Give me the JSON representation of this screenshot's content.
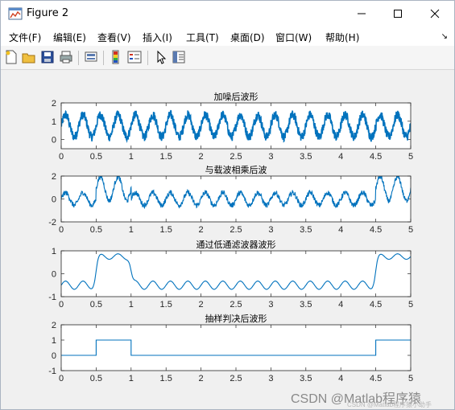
{
  "window": {
    "title": "Figure 2"
  },
  "menu": {
    "items": [
      "文件(F)",
      "编辑(E)",
      "查看(V)",
      "插入(I)",
      "工具(T)",
      "桌面(D)",
      "窗口(W)",
      "帮助(H)"
    ],
    "overflow_arrow": "↘"
  },
  "toolbar": {
    "icons": [
      "new-figure-icon",
      "open-file-icon",
      "save-icon",
      "print-icon",
      "link-plot-icon",
      "insert-colorbar-icon",
      "insert-legend-icon",
      "pointer-icon",
      "property-inspector-icon"
    ]
  },
  "colors": {
    "line": "#0072bd",
    "axes_bg": "#ffffff",
    "figure_bg": "#f0f0f0",
    "axis": "#262626"
  },
  "chart_data": [
    {
      "type": "line",
      "title": "加噪后波形",
      "xlim": [
        0,
        5
      ],
      "ylim": [
        -0.5,
        2
      ],
      "xticks": [
        "0",
        "0.5",
        "1",
        "1.5",
        "2",
        "2.5",
        "3",
        "3.5",
        "4",
        "4.5",
        "5"
      ],
      "yticks": [
        "0",
        "1",
        "2"
      ],
      "series": [
        {
          "x": [
            0,
            5
          ],
          "description_values": {
            "carrier_cycles": 20,
            "center": 0.75,
            "amplitude": 0.6,
            "noise": 0.22
          }
        }
      ]
    },
    {
      "type": "line",
      "title": "与载波相乘后波",
      "xlim": [
        0,
        5
      ],
      "ylim": [
        -2,
        2
      ],
      "xticks": [
        "0",
        "0.5",
        "1",
        "1.5",
        "2",
        "2.5",
        "3",
        "3.5",
        "4",
        "4.5",
        "5"
      ],
      "yticks": [
        "-2",
        "0",
        "2"
      ],
      "series": [
        {
          "x": [
            0,
            5
          ],
          "description_values": {
            "high_intervals": [
              [
                0.5,
                1
              ],
              [
                4.5,
                5
              ]
            ]
          }
        }
      ]
    },
    {
      "type": "line",
      "title": "通过低通滤波器波形",
      "xlim": [
        0,
        5
      ],
      "ylim": [
        -1,
        1
      ],
      "xticks": [
        "0",
        "0.5",
        "1",
        "1.5",
        "2",
        "2.5",
        "3",
        "3.5",
        "4",
        "4.5",
        "5"
      ],
      "yticks": [
        "-1",
        "0",
        "1"
      ],
      "series": [
        {
          "x": [
            0,
            5
          ],
          "description_values": {
            "high_intervals": [
              [
                0.5,
                1
              ],
              [
                4.5,
                5
              ]
            ]
          }
        }
      ]
    },
    {
      "type": "line",
      "title": "抽样判决后波形",
      "xlim": [
        0,
        5
      ],
      "ylim": [
        -1,
        2
      ],
      "xticks": [
        "0",
        "0.5",
        "1",
        "1.5",
        "2",
        "2.5",
        "3",
        "3.5",
        "4",
        "4.5",
        "5"
      ],
      "yticks": [
        "-1",
        "0",
        "1",
        "2"
      ],
      "series": [
        {
          "x": [
            0,
            0.5,
            0.5,
            1,
            1,
            4.5,
            4.5,
            5
          ],
          "y": [
            0,
            0,
            1,
            1,
            0,
            0,
            1,
            1
          ]
        }
      ]
    }
  ],
  "watermark": {
    "main": "CSDN @Matlab程序猿",
    "sub": "CSDN @Matlab程序猿小助手"
  }
}
